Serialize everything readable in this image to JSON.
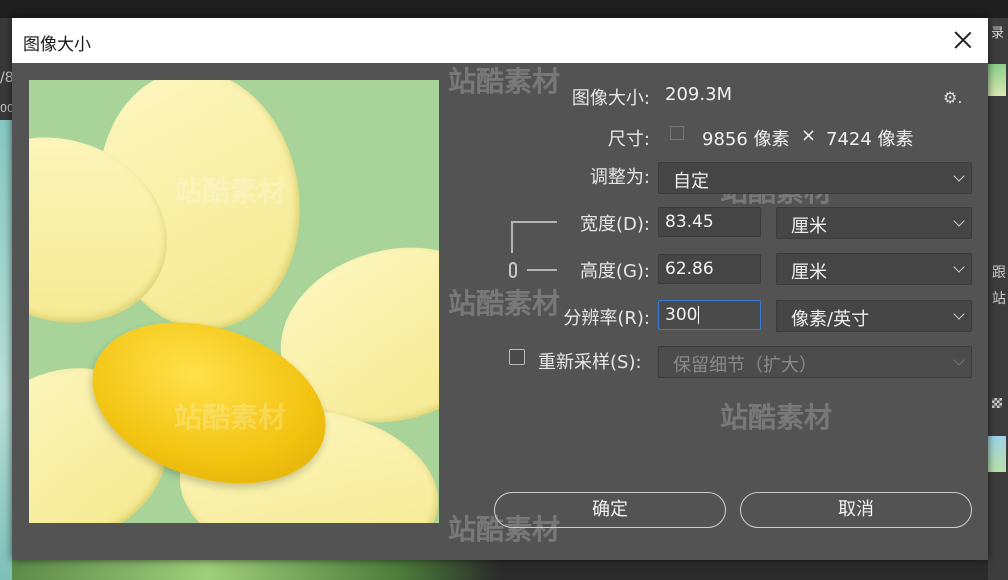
{
  "dialog": {
    "title": "图像大小",
    "close_icon": "close-icon"
  },
  "info": {
    "image_size_label": "图像大小:",
    "image_size_value": "209.3M",
    "dimensions_label": "尺寸:",
    "width_px": "9856 像素",
    "times": "×",
    "height_px": "7424 像素",
    "settings_icon": "gear-icon",
    "settings_glyph": "⚙."
  },
  "fit_to": {
    "label": "调整为:",
    "value": "自定"
  },
  "width": {
    "label": "宽度(D):",
    "value": "83.45",
    "unit": "厘米"
  },
  "height": {
    "label": "高度(G):",
    "value": "62.86",
    "unit": "厘米"
  },
  "resolution": {
    "label": "分辨率(R):",
    "value": "300",
    "unit": "像素/英寸"
  },
  "resample": {
    "label": "重新采样(S):",
    "checked": false,
    "value": "保留细节（扩大）"
  },
  "buttons": {
    "ok": "确定",
    "cancel": "取消"
  },
  "watermark": "站酷素材",
  "background": {
    "left_text": "/8",
    "left_text2": "00",
    "right_label": "录",
    "right_char1": "跟",
    "right_char2": "站"
  },
  "colors": {
    "dialog_bg": "#535353",
    "field_bg": "#454545",
    "focus_border": "#3a7bd5"
  }
}
